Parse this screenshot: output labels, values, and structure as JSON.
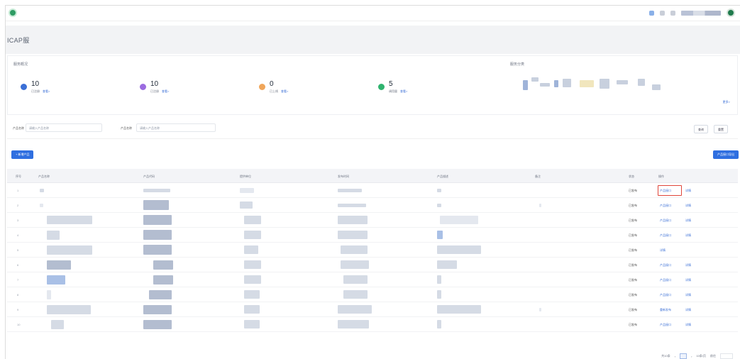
{
  "page": {
    "title": "ICAP服"
  },
  "stats": {
    "heading": "服务概况",
    "items": [
      {
        "value": "10",
        "label": "已注册",
        "link": "查看>",
        "color": "#3b6fd6"
      },
      {
        "value": "10",
        "label": "已注册",
        "link": "查看>",
        "color": "#9b6be0"
      },
      {
        "value": "0",
        "label": "已上线",
        "link": "查看>",
        "color": "#f0a65a"
      },
      {
        "value": "5",
        "label": "调用量",
        "link": "查看>",
        "color": "#2fb36e"
      }
    ],
    "side_heading": "服务分类",
    "side_more": "更多>"
  },
  "filter": {
    "label1": "产品名称",
    "placeholder1": "请输入产品名称",
    "label2": "产品名称",
    "placeholder2": "请输入产品名称",
    "search": "查询",
    "reset": "重置"
  },
  "actions": {
    "add": "+ 新增产品",
    "export": "产品接口导出"
  },
  "table": {
    "headers": [
      "序号",
      "产品名称",
      "产品代码",
      "提供单位",
      "发布时间",
      "产品描述",
      "备注",
      "状态",
      "操作"
    ],
    "rows": [
      {
        "idx": "1",
        "status": "已发布",
        "op1": "产品接口",
        "op2": "详情"
      },
      {
        "idx": "2",
        "status": "已发布",
        "op1": "产品接口",
        "op2": "详情"
      },
      {
        "idx": "3",
        "status": "已发布",
        "op1": "产品接口",
        "op2": "详情"
      },
      {
        "idx": "4",
        "status": "已发布",
        "op1": "产品接口",
        "op2": "详情"
      },
      {
        "idx": "5",
        "status": "已发布",
        "op1": "详情",
        "op2": ""
      },
      {
        "idx": "6",
        "status": "已发布",
        "op1": "产品接口",
        "op2": "详情"
      },
      {
        "idx": "7",
        "status": "已发布",
        "op1": "产品接口",
        "op2": "详情"
      },
      {
        "idx": "8",
        "status": "已发布",
        "op1": "产品接口",
        "op2": "详情"
      },
      {
        "idx": "9",
        "status": "已发布",
        "op1": "重新发布",
        "op2": "详情"
      },
      {
        "idx": "10",
        "status": "已发布",
        "op1": "产品接口",
        "op2": "详情"
      }
    ]
  },
  "pager": {
    "total": "共10条",
    "page": "1",
    "size": "10条/页",
    "goto": "前往"
  }
}
